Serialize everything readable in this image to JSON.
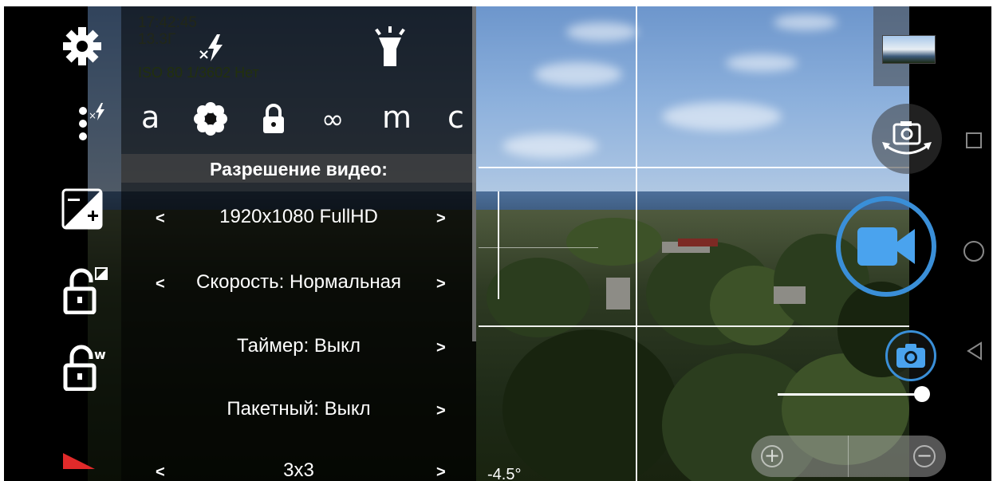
{
  "osd": {
    "time": "17:42:45",
    "free": "13.3Г",
    "iso_line": "ISO 80  1/3602  Нет"
  },
  "modes": [
    "a",
    "∞",
    "m",
    "c"
  ],
  "menu": {
    "title": "Разрешение видео:",
    "rows": [
      {
        "value": "1920x1080 FullHD",
        "left": "<",
        "right": ">"
      },
      {
        "value": "Скорость: Нормальная",
        "left": "<",
        "right": ">"
      },
      {
        "value": "Таймер: Выкл",
        "right": ">"
      },
      {
        "value": "Пакетный: Выкл",
        "right": ">"
      },
      {
        "value": "3x3",
        "left": "<",
        "right": ">"
      }
    ]
  },
  "level_angle": "-4.5°",
  "zoom": {
    "level": 0.95
  },
  "icons": {
    "settings": "gear-icon",
    "popup": "more-vert-flash-icon",
    "exposure": "exposure-icon",
    "lock_exposure": "lock-exposure-icon",
    "lock_wb": "lock-white-balance-icon",
    "flash": "flash-off-icon",
    "torch": "torch-icon",
    "switch_camera": "switch-camera-icon",
    "record": "video-record-icon",
    "photo": "photo-snapshot-icon",
    "zoom_in": "zoom-in-icon",
    "zoom_out": "zoom-out-icon"
  },
  "colors": {
    "accent": "#4aa3ee",
    "record_ring": "#3a8fd8",
    "indicator_red": "#e02a2a"
  }
}
